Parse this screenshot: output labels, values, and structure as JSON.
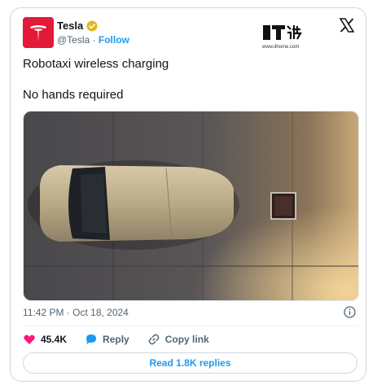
{
  "author": {
    "name": "Tesla",
    "handle": "@Tesla",
    "separator": "·",
    "follow_label": "Follow",
    "avatar_color": "#e31937"
  },
  "watermark": {
    "site": "www.ithome.com"
  },
  "post": {
    "line1": "Robotaxi wireless charging",
    "line2": "No hands required",
    "timestamp": "11:42 PM · Oct 18, 2024"
  },
  "actions": {
    "likes": "45.4K",
    "reply_label": "Reply",
    "copy_link_label": "Copy link"
  },
  "read_replies_label": "Read 1.8K replies",
  "colors": {
    "accent": "#1d9bf0",
    "like": "#f91880",
    "verified": "#e2b719",
    "secondary_text": "#536471"
  },
  "icons": [
    "tesla-logo-icon",
    "verified-badge-icon",
    "x-logo-icon",
    "info-icon",
    "heart-icon",
    "reply-bubble-icon",
    "link-icon"
  ]
}
